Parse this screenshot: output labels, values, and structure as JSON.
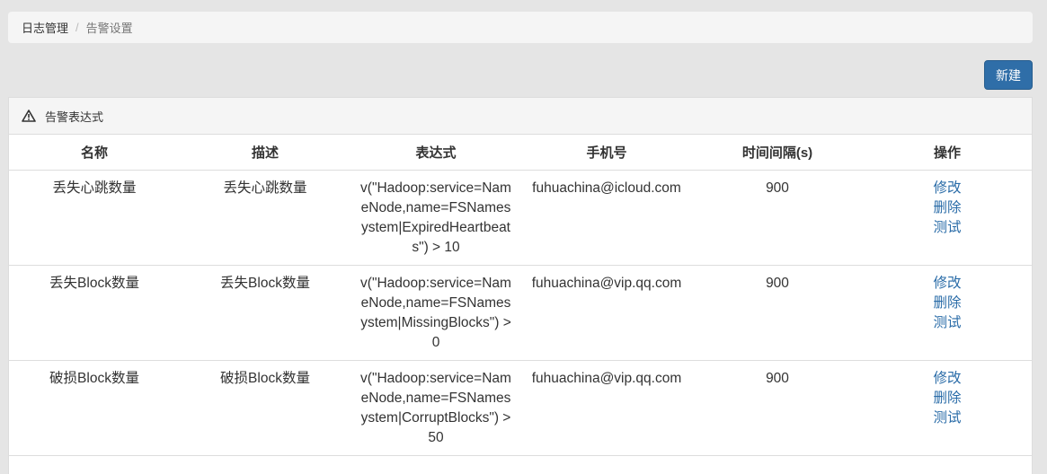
{
  "breadcrumb": {
    "parent": "日志管理",
    "separator": "/",
    "current": "告警设置"
  },
  "toolbar": {
    "new_label": "新建"
  },
  "panel": {
    "title": "告警表达式",
    "icon": "warning-triangle-icon"
  },
  "table": {
    "headers": [
      "名称",
      "描述",
      "表达式",
      "手机号",
      "时间间隔(s)",
      "操作"
    ],
    "rows": [
      {
        "name": "丢失心跳数量",
        "desc": "丢失心跳数量",
        "expr": "v(\"Hadoop:service=NameNode,name=FSNamesystem|ExpiredHeartbeats\") > 10",
        "contact": "fuhuachina@icloud.com",
        "interval": "900",
        "ops": [
          "修改",
          "删除",
          "测试"
        ]
      },
      {
        "name": "丢失Block数量",
        "desc": "丢失Block数量",
        "expr": "v(\"Hadoop:service=NameNode,name=FSNamesystem|MissingBlocks\") > 0",
        "contact": "fuhuachina@vip.qq.com",
        "interval": "900",
        "ops": [
          "修改",
          "删除",
          "测试"
        ]
      },
      {
        "name": "破损Block数量",
        "desc": "破损Block数量",
        "expr": "v(\"Hadoop:service=NameNode,name=FSNamesystem|CorruptBlocks\") > 50",
        "contact": "fuhuachina@vip.qq.com",
        "interval": "900",
        "ops": [
          "修改",
          "删除",
          "测试"
        ]
      }
    ]
  },
  "colors": {
    "primary": "#2f6ea8",
    "link": "#2a6ca8",
    "background": "#e5e5e5"
  }
}
